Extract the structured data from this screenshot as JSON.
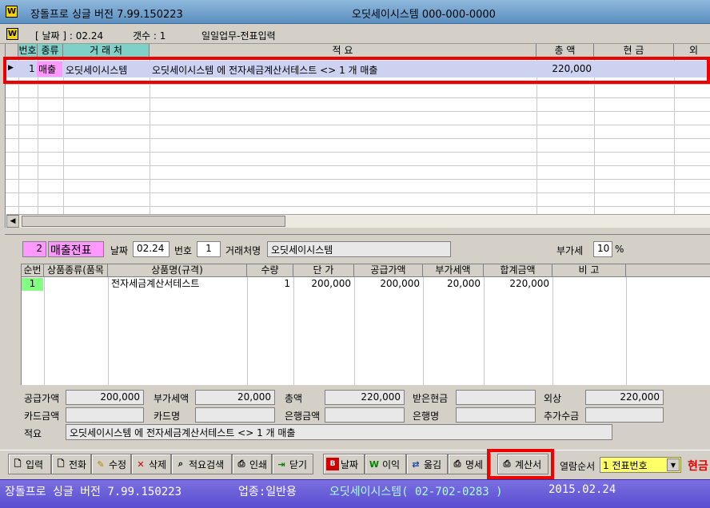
{
  "window": {
    "title": "장돌프로 싱글 버전 7.99.150223",
    "company_title": "오딧세이시스템 000-000-0000"
  },
  "info": {
    "date": "[ 날짜 ] : 02.24",
    "count": "갯수 : 1",
    "mode": "일일업무-전표입력"
  },
  "upper_grid": {
    "headers": [
      "번호",
      "종류",
      "거 래 처",
      "적 요",
      "총 액",
      "현 금",
      "외"
    ],
    "row": {
      "no": "1",
      "type": "매출",
      "vendor": "오딧세이시스템",
      "summary": "오딧세이시스템 에 전자세금계산서테스트 <> 1 개 매출",
      "total": "220,000",
      "cash": "",
      "credit": ""
    }
  },
  "voucher": {
    "no": "2",
    "kind": "매출전표",
    "date_label": "날짜",
    "date": "02.24",
    "number_label": "번호",
    "number": "1",
    "vendor_label": "거래처명",
    "vendor": "오딧세이시스템",
    "vat_label": "부가세",
    "vat": "10",
    "vat_unit": "%"
  },
  "lower_grid": {
    "headers": [
      "순번",
      "상품종류(품목",
      "상품명(규격)",
      "수량",
      "단 가",
      "공급가액",
      "부가세액",
      "합계금액",
      "비 고"
    ],
    "row": {
      "seq": "1",
      "category": "",
      "name": "전자세금계산서테스트",
      "qty": "1",
      "unit_price": "200,000",
      "supply": "200,000",
      "vat": "20,000",
      "total": "220,000",
      "note": ""
    }
  },
  "summary": {
    "supply_label": "공급가액",
    "supply": "200,000",
    "vat_label": "부가세액",
    "vat": "20,000",
    "total_label": "총액",
    "total": "220,000",
    "cash_label": "받은현금",
    "cash": "",
    "credit_label": "외상",
    "credit": "220,000",
    "card_amount_label": "카드금액",
    "card_amount": "",
    "card_name_label": "카드명",
    "card_name": "",
    "bank_amount_label": "은행금액",
    "bank_amount": "",
    "bank_name_label": "은행명",
    "bank_name": "",
    "extra_label": "추가수금",
    "extra": "",
    "memo_label": "적요",
    "memo": "오딧세이시스템 에 전자세금계산서테스트 <> 1 개 매출"
  },
  "toolbar": {
    "input": "입력",
    "phone": "전화",
    "edit": "수정",
    "delete": "삭제",
    "search": "적요검색",
    "print": "인쇄",
    "close": "닫기",
    "date": "날짜",
    "profit": "이익",
    "move": "옮김",
    "statement": "명세",
    "invoice": "계산서",
    "sort_label": "열람순서",
    "sort_value": "1 전표번호",
    "cash_mark": "현금"
  },
  "statusbar": {
    "product": "장돌프로 싱글 버전 7.99.150223",
    "business": "업종:일반용",
    "company": "오딧세이시스템( 02-702-0283 )",
    "date": "2015.02.24"
  },
  "colors": {
    "highlight_border": "#ee0000",
    "selected_row": "#cdd2f0",
    "type_pink": "#ff99ff",
    "voucher_kind": "#ff99ff",
    "status_bar": "#5a4dd0",
    "sort_field": "#ffff66",
    "seq_green": "#80ff80"
  }
}
